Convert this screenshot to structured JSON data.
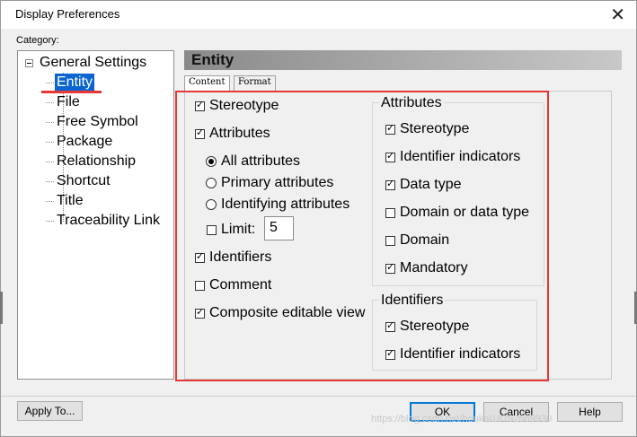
{
  "window": {
    "title": "Display Preferences",
    "close_glyph": "✕"
  },
  "category_label": "Category:",
  "tree": {
    "root": "General Settings",
    "items": [
      "Entity",
      "File",
      "Free Symbol",
      "Package",
      "Relationship",
      "Shortcut",
      "Title",
      "Traceability Link"
    ],
    "selected": "Entity"
  },
  "section_header": "Entity",
  "tabs": [
    "Content",
    "Format"
  ],
  "content": {
    "stereotype": {
      "label": "Stereotype",
      "checked": true
    },
    "attributes": {
      "label": "Attributes",
      "checked": true
    },
    "radio_all": {
      "label": "All attributes",
      "selected": true
    },
    "radio_primary": {
      "label": "Primary attributes",
      "selected": false
    },
    "radio_identifying": {
      "label": "Identifying attributes",
      "selected": false
    },
    "limit": {
      "label": "Limit:",
      "checked": false,
      "value": "5"
    },
    "identifiers": {
      "label": "Identifiers",
      "checked": true
    },
    "comment": {
      "label": "Comment",
      "checked": false
    },
    "composite": {
      "label": "Composite editable view",
      "checked": true
    }
  },
  "attributes_group": {
    "title": "Attributes",
    "items": [
      {
        "label": "Stereotype",
        "checked": true
      },
      {
        "label": "Identifier indicators",
        "checked": true
      },
      {
        "label": "Data type",
        "checked": true
      },
      {
        "label": "Domain or data type",
        "checked": false
      },
      {
        "label": "Domain",
        "checked": false
      },
      {
        "label": "Mandatory",
        "checked": true
      }
    ]
  },
  "identifiers_group": {
    "title": "Identifiers",
    "items": [
      {
        "label": "Stereotype",
        "checked": true
      },
      {
        "label": "Identifier indicators",
        "checked": true
      }
    ]
  },
  "buttons": {
    "apply_to": "Apply To...",
    "ok": "OK",
    "cancel": "Cancel",
    "help": "Help"
  },
  "watermark": "https://blog.csdn.net/houkai18792669930",
  "colors": {
    "selection": "#0a64d2",
    "highlight_box": "#e53935"
  }
}
